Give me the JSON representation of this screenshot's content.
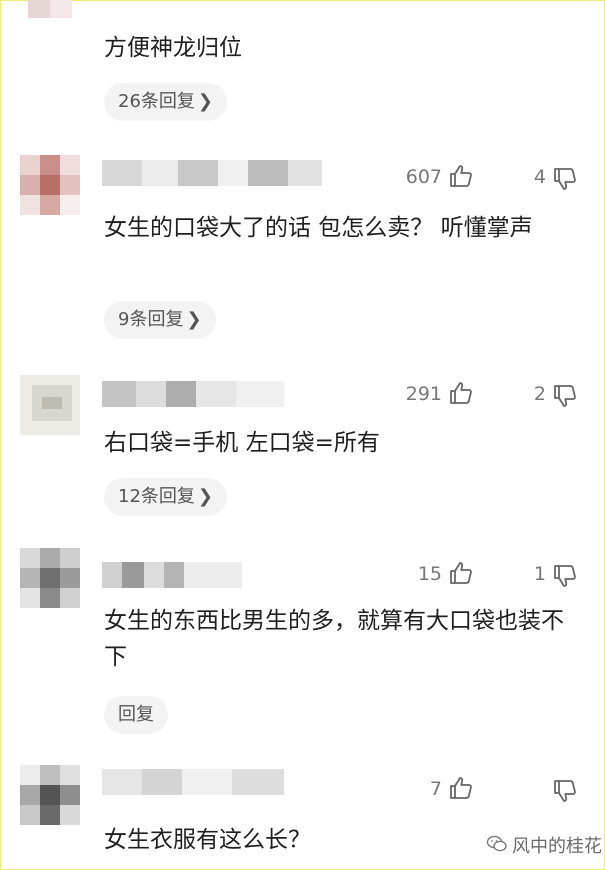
{
  "comments": [
    {
      "text": "方便神龙归位",
      "reply": "26条回复",
      "reply_chev": "❯"
    },
    {
      "likes": "607",
      "dislikes": "4",
      "text": "女生的口袋大了的话  包怎么卖？  听懂掌声",
      "reply": "9条回复",
      "reply_chev": "❯"
    },
    {
      "likes": "291",
      "dislikes": "2",
      "text": "右口袋=手机  左口袋=所有",
      "reply": "12条回复",
      "reply_chev": "❯"
    },
    {
      "likes": "15",
      "dislikes": "1",
      "text": "女生的东西比男生的多，就算有大口袋也装不下",
      "reply": "回复"
    },
    {
      "likes": "7",
      "text": "女生衣服有这么长？"
    }
  ],
  "icons": {
    "like": "thumbs-up-icon",
    "dislike": "thumbs-down-icon",
    "watermark": "wechat-icon"
  },
  "watermark": "风中的桂花"
}
